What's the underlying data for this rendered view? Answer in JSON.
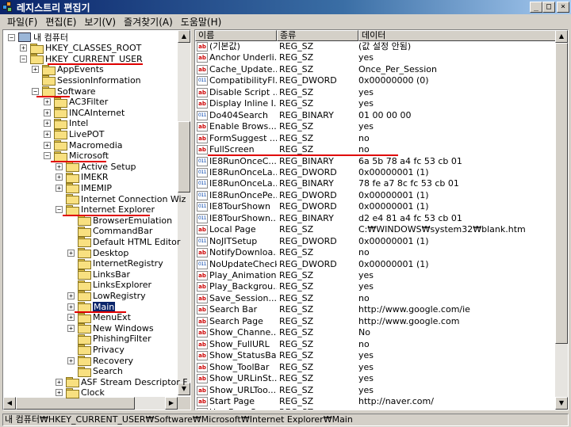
{
  "window": {
    "title": "레지스트리 편집기",
    "minimize": "_",
    "maximize": "□",
    "close": "×"
  },
  "menu": [
    "파일(F)",
    "편집(E)",
    "보기(V)",
    "즐겨찾기(A)",
    "도움말(H)"
  ],
  "tree": [
    {
      "label": "내 컴퓨터",
      "level": 0,
      "expander": "−",
      "icon": "computer-icon"
    },
    {
      "label": "HKEY_CLASSES_ROOT",
      "level": 1,
      "expander": "+"
    },
    {
      "label": "HKEY_CURRENT_USER",
      "level": 1,
      "expander": "−"
    },
    {
      "label": "AppEvents",
      "level": 2,
      "expander": "+"
    },
    {
      "label": "SessionInformation",
      "level": 2,
      "expander": ""
    },
    {
      "label": "Software",
      "level": 2,
      "expander": "−"
    },
    {
      "label": "AC3Filter",
      "level": 3,
      "expander": "+"
    },
    {
      "label": "INCAInternet",
      "level": 3,
      "expander": "+"
    },
    {
      "label": "Intel",
      "level": 3,
      "expander": "+"
    },
    {
      "label": "LivePOT",
      "level": 3,
      "expander": "+"
    },
    {
      "label": "Macromedia",
      "level": 3,
      "expander": "+"
    },
    {
      "label": "Microsoft",
      "level": 3,
      "expander": "−"
    },
    {
      "label": "Active Setup",
      "level": 4,
      "expander": "+"
    },
    {
      "label": "IMEKR",
      "level": 4,
      "expander": "+"
    },
    {
      "label": "IMEMIP",
      "level": 4,
      "expander": "+"
    },
    {
      "label": "Internet Connection Wiz",
      "level": 4,
      "expander": ""
    },
    {
      "label": "Internet Explorer",
      "level": 4,
      "expander": "−"
    },
    {
      "label": "BrowserEmulation",
      "level": 5,
      "expander": ""
    },
    {
      "label": "CommandBar",
      "level": 5,
      "expander": ""
    },
    {
      "label": "Default HTML Editor",
      "level": 5,
      "expander": ""
    },
    {
      "label": "Desktop",
      "level": 5,
      "expander": "+"
    },
    {
      "label": "InternetRegistry",
      "level": 5,
      "expander": ""
    },
    {
      "label": "LinksBar",
      "level": 5,
      "expander": ""
    },
    {
      "label": "LinksExplorer",
      "level": 5,
      "expander": ""
    },
    {
      "label": "LowRegistry",
      "level": 5,
      "expander": "+"
    },
    {
      "label": "Main",
      "level": 5,
      "expander": "+",
      "selected": true
    },
    {
      "label": "MenuExt",
      "level": 5,
      "expander": "+"
    },
    {
      "label": "New Windows",
      "level": 5,
      "expander": "+"
    },
    {
      "label": "PhishingFilter",
      "level": 5,
      "expander": ""
    },
    {
      "label": "Privacy",
      "level": 5,
      "expander": ""
    },
    {
      "label": "Recovery",
      "level": 5,
      "expander": "+"
    },
    {
      "label": "Search",
      "level": 5,
      "expander": ""
    },
    {
      "label": "ASF Stream Descriptor F",
      "level": 4,
      "expander": "+"
    },
    {
      "label": "Clock",
      "level": 4,
      "expander": "+"
    }
  ],
  "columns": [
    "이름",
    "종류",
    "데이터"
  ],
  "values": [
    {
      "name": "(기본값)",
      "type": "REG_SZ",
      "data": "(값 설정 안됨)",
      "icon": "ab"
    },
    {
      "name": "Anchor Underli...",
      "type": "REG_SZ",
      "data": "yes",
      "icon": "ab"
    },
    {
      "name": "Cache_Update...",
      "type": "REG_SZ",
      "data": "Once_Per_Session",
      "icon": "ab"
    },
    {
      "name": "CompatibilityFl...",
      "type": "REG_DWORD",
      "data": "0x00000000 (0)",
      "icon": "bin"
    },
    {
      "name": "Disable Script ...",
      "type": "REG_SZ",
      "data": "yes",
      "icon": "ab"
    },
    {
      "name": "Display Inline I...",
      "type": "REG_SZ",
      "data": "yes",
      "icon": "ab"
    },
    {
      "name": "Do404Search",
      "type": "REG_BINARY",
      "data": "01 00 00 00",
      "icon": "bin"
    },
    {
      "name": "Enable Brows...",
      "type": "REG_SZ",
      "data": "yes",
      "icon": "ab"
    },
    {
      "name": "FormSuggest ...",
      "type": "REG_SZ",
      "data": "no",
      "icon": "ab"
    },
    {
      "name": "FullScreen",
      "type": "REG_SZ",
      "data": "no",
      "icon": "ab"
    },
    {
      "name": "IE8RunOnceC...",
      "type": "REG_BINARY",
      "data": "6a 5b 78 a4 fc 53 cb 01",
      "icon": "bin"
    },
    {
      "name": "IE8RunOnceLa...",
      "type": "REG_DWORD",
      "data": "0x00000001 (1)",
      "icon": "bin"
    },
    {
      "name": "IE8RunOnceLa...",
      "type": "REG_BINARY",
      "data": "78 fe a7 8c fc 53 cb 01",
      "icon": "bin"
    },
    {
      "name": "IE8RunOncePe...",
      "type": "REG_DWORD",
      "data": "0x00000001 (1)",
      "icon": "bin"
    },
    {
      "name": "IE8TourShown",
      "type": "REG_DWORD",
      "data": "0x00000001 (1)",
      "icon": "bin"
    },
    {
      "name": "IE8TourShown...",
      "type": "REG_BINARY",
      "data": "d2 e4 81 a4 fc 53 cb 01",
      "icon": "bin"
    },
    {
      "name": "Local Page",
      "type": "REG_SZ",
      "data": "C:₩WINDOWS₩system32₩blank.htm",
      "icon": "ab"
    },
    {
      "name": "NoJITSetup",
      "type": "REG_DWORD",
      "data": "0x00000001 (1)",
      "icon": "bin"
    },
    {
      "name": "NotifyDownloa...",
      "type": "REG_SZ",
      "data": "no",
      "icon": "ab"
    },
    {
      "name": "NoUpdateCheck",
      "type": "REG_DWORD",
      "data": "0x00000001 (1)",
      "icon": "bin"
    },
    {
      "name": "Play_Animations",
      "type": "REG_SZ",
      "data": "yes",
      "icon": "ab"
    },
    {
      "name": "Play_Backgrou...",
      "type": "REG_SZ",
      "data": "yes",
      "icon": "ab"
    },
    {
      "name": "Save_Session...",
      "type": "REG_SZ",
      "data": "no",
      "icon": "ab"
    },
    {
      "name": "Search Bar",
      "type": "REG_SZ",
      "data": "http://www.google.com/ie",
      "icon": "ab"
    },
    {
      "name": "Search Page",
      "type": "REG_SZ",
      "data": "http://www.google.com",
      "icon": "ab"
    },
    {
      "name": "Show_Channe...",
      "type": "REG_SZ",
      "data": "No",
      "icon": "ab"
    },
    {
      "name": "Show_FullURL",
      "type": "REG_SZ",
      "data": "no",
      "icon": "ab"
    },
    {
      "name": "Show_StatusBar",
      "type": "REG_SZ",
      "data": "yes",
      "icon": "ab"
    },
    {
      "name": "Show_ToolBar",
      "type": "REG_SZ",
      "data": "yes",
      "icon": "ab"
    },
    {
      "name": "Show_URLinSt...",
      "type": "REG_SZ",
      "data": "yes",
      "icon": "ab"
    },
    {
      "name": "Show_URLToo...",
      "type": "REG_SZ",
      "data": "yes",
      "icon": "ab"
    },
    {
      "name": "Start Page",
      "type": "REG_SZ",
      "data": "http://naver.com/",
      "icon": "ab"
    },
    {
      "name": "Use FormSugg...",
      "type": "REG_SZ",
      "data": "",
      "icon": "ab"
    }
  ],
  "status": "내 컴퓨터₩HKEY_CURRENT_USER₩Software₩Microsoft₩Internet Explorer₩Main",
  "colors": {
    "selection": "#0a246a",
    "highlight_line": "#e00000",
    "titlebar": "#0a246a"
  }
}
